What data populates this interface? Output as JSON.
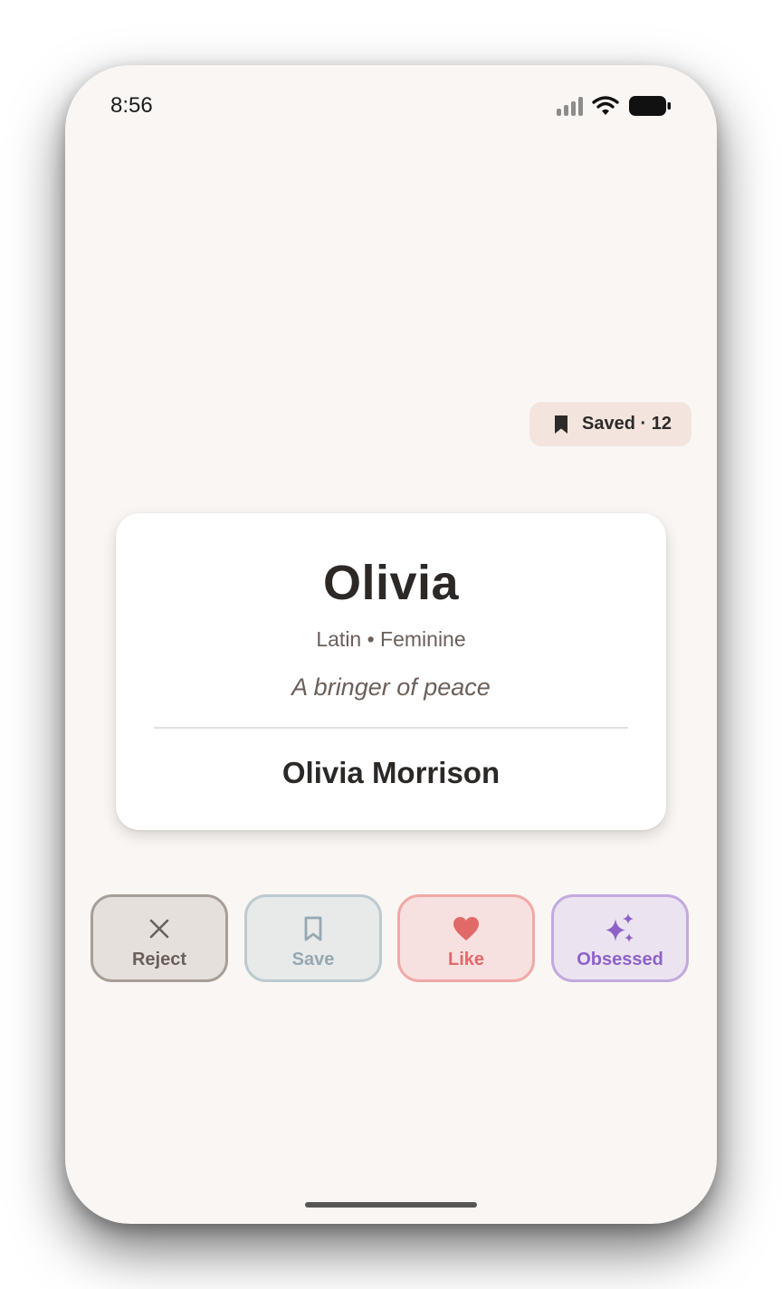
{
  "status_bar": {
    "time": "8:56",
    "icons": [
      "cellular-signal-icon",
      "wifi-icon",
      "battery-icon"
    ]
  },
  "saved_badge": {
    "icon": "bookmark-icon",
    "label": "Saved · 12"
  },
  "name_card": {
    "name": "Olivia",
    "origin": "Latin • Feminine",
    "meaning": "A bringer of peace",
    "full_name": "Olivia Morrison"
  },
  "actions": [
    {
      "label": "Reject",
      "icon": "close-icon",
      "color": "#6a5f59"
    },
    {
      "label": "Save",
      "icon": "bookmark-outline-icon",
      "color": "#95a8b1"
    },
    {
      "label": "Like",
      "icon": "heart-icon",
      "color": "#e16a69"
    },
    {
      "label": "Obsessed",
      "icon": "sparkles-icon",
      "color": "#8d62c8"
    }
  ],
  "colors": {
    "background": "#faf6f3",
    "card": "#ffffff",
    "text_primary": "#2b2826",
    "text_secondary": "#6a5f59"
  }
}
